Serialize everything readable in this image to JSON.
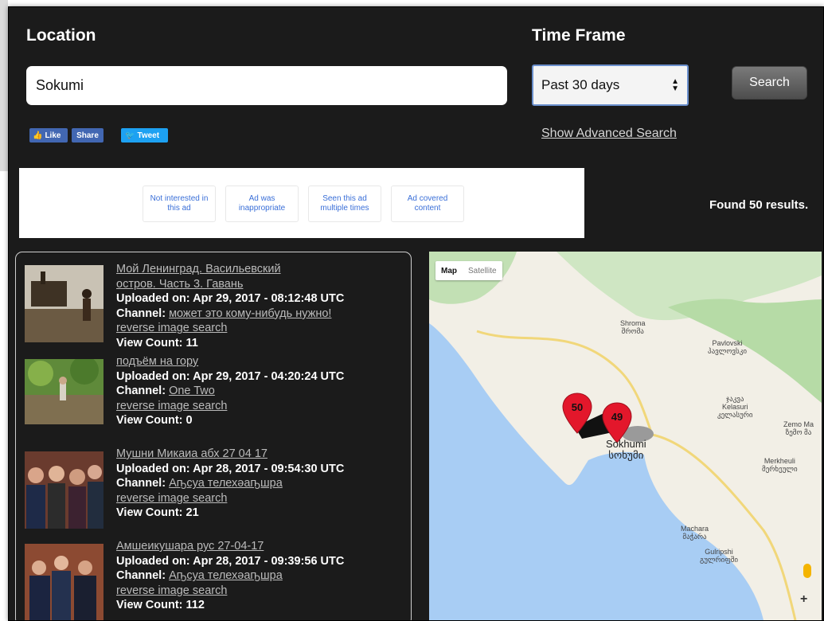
{
  "search": {
    "location_label": "Location",
    "location_value": "Sokumi",
    "timeframe_label": "Time Frame",
    "timeframe_selected": "Past 30 days",
    "search_button": "Search",
    "advanced_link": "Show Advanced Search"
  },
  "social": {
    "like": "Like",
    "share": "Share",
    "tweet": "Tweet"
  },
  "ad": {
    "options": [
      "Not interested in this ad",
      "Ad was inappropriate",
      "Seen this ad multiple times",
      "Ad covered content"
    ]
  },
  "results_summary": "Found 50 results.",
  "labels": {
    "uploaded": "Uploaded on:",
    "channel": "Channel:",
    "reverse": "reverse image search",
    "views": "View Count:"
  },
  "results": [
    {
      "title_line1": "Мой Ленинград. Васильевский",
      "title_line2": "остров. Часть 3. Гавань",
      "uploaded": "Apr 29, 2017 - 08:12:48 UTC",
      "channel": "может это кому-нибудь нужно!",
      "views": "11"
    },
    {
      "title_line1": "подъём на гору",
      "uploaded": "Apr 29, 2017 - 04:20:24 UTC",
      "channel": "One Two",
      "views": "0"
    },
    {
      "title_line1": "Мушни Микаиа абх 27 04 17",
      "uploaded": "Apr 28, 2017 - 09:54:30 UTC",
      "channel": "Аҧсуа телехәаҧшра",
      "views": "21"
    },
    {
      "title_line1": "Амшеикушара рус 27-04-17",
      "uploaded": "Apr 28, 2017 - 09:39:56 UTC",
      "channel": "Аҧсуа телехәаҧшра",
      "views": "112"
    }
  ],
  "map": {
    "tab_map": "Map",
    "tab_satellite": "Satellite",
    "marker_1": "50",
    "marker_2": "49",
    "zoom_in": "+",
    "places": {
      "shroma": "Shroma",
      "shroma_ka": "შრომა",
      "pavlovski": "Pavlovski",
      "pavlovski_ka": "პავლოვსკი",
      "kelasuri_top": "ჯაკვა",
      "kelasuri": "Kelasuri",
      "kelasuri_ka": "კელასური",
      "zemo": "Zemo Ma",
      "zemo_ka": "ზემო მა",
      "sokhumi": "Sokhumi",
      "sokhumi_ka": "სოხუმი",
      "merkheuli": "Merkheuli",
      "merkheuli_ka": "მერხეული",
      "machara": "Machara",
      "machara_ka": "მაჭარა",
      "gulripshi": "Gulripshi",
      "gulripshi_ka": "გულრიფში"
    }
  }
}
